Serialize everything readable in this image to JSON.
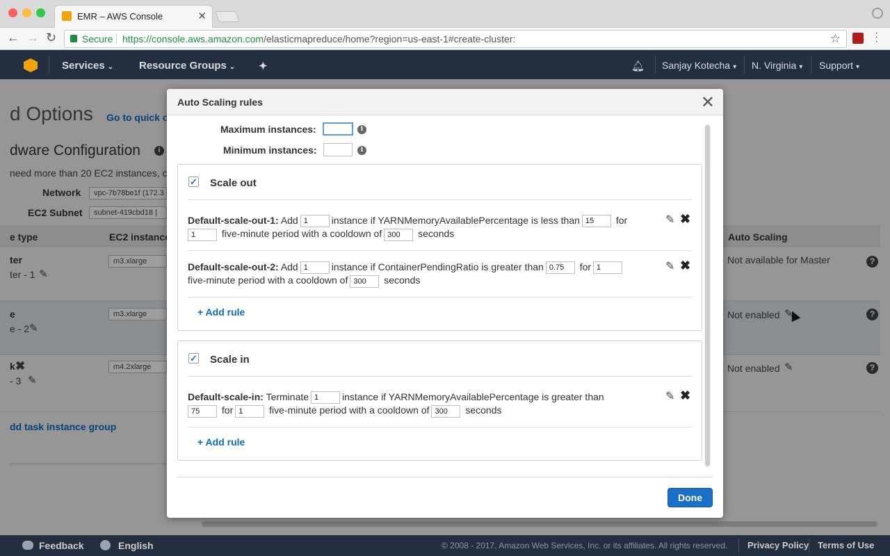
{
  "browser": {
    "tab_title": "EMR – AWS Console",
    "secure_label": "Secure",
    "url_host": "https://console.aws.amazon.com",
    "url_path": "/elasticmapreduce/home?region=us-east-1#create-cluster:"
  },
  "aws_header": {
    "services": "Services",
    "resource_groups": "Resource Groups",
    "user": "Sanjay Kotecha",
    "region": "N. Virginia",
    "support": "Support"
  },
  "background": {
    "options_heading": "d Options",
    "go_to_quick": "Go to quick o",
    "hardware_heading": "dware Configuration",
    "ec2_note": "need more than 20 EC2 instances, c",
    "network_label": "Network",
    "network_value": "vpc-7b78be1f (172.3",
    "subnet_label": "EC2 Subnet",
    "subnet_value": "subnet-419cbd18 |",
    "col_type": "e type",
    "col_ec2": "EC2 instance",
    "col_autoscaling": "Auto Scaling",
    "rows": [
      {
        "type": "ter",
        "name": "ter - 1",
        "instance": "m3.xlarge",
        "auto": "Not available for Master"
      },
      {
        "type": "e",
        "name": "e - 2",
        "instance": "m3.xlarge",
        "auto": "Not enabled"
      },
      {
        "type": "k",
        "name": "- 3",
        "instance": "m4.2xlarge",
        "auto": "Not enabled"
      }
    ],
    "add_task_group": "dd task instance group"
  },
  "modal": {
    "title": "Auto Scaling rules",
    "max_label": "Maximum instances:",
    "max_value": "",
    "min_label": "Minimum instances:",
    "min_value": "",
    "scale_out": {
      "title": "Scale out",
      "rules": [
        {
          "name": "Default-scale-out-1:",
          "action": "Add",
          "count": "1",
          "metric_text": "instance if YARNMemoryAvailablePercentage is less than",
          "threshold": "15",
          "for_text": "for",
          "periods": "1",
          "period_text": "five-minute period with a cooldown of",
          "cooldown": "300",
          "seconds": "seconds"
        },
        {
          "name": "Default-scale-out-2:",
          "action": "Add",
          "count": "1",
          "metric_text": "instance if ContainerPendingRatio is greater than",
          "threshold": "0.75",
          "for_text": "for",
          "periods": "1",
          "period_text": "five-minute period with a cooldown of",
          "cooldown": "300",
          "seconds": "seconds"
        }
      ],
      "add_rule": "+ Add rule"
    },
    "scale_in": {
      "title": "Scale in",
      "rule": {
        "name": "Default-scale-in:",
        "action": "Terminate",
        "count": "1",
        "metric_text": "instance if YARNMemoryAvailablePercentage is greater than",
        "threshold": "75",
        "for_text": "for",
        "periods": "1",
        "period_text": "five-minute period with a cooldown of",
        "cooldown": "300",
        "seconds": "seconds"
      },
      "add_rule": "+ Add rule"
    },
    "done": "Done"
  },
  "footer": {
    "feedback": "Feedback",
    "language": "English",
    "copyright": "© 2008 - 2017, Amazon Web Services, Inc. or its affiliates. All rights reserved.",
    "privacy": "Privacy Policy",
    "terms": "Terms of Use"
  }
}
